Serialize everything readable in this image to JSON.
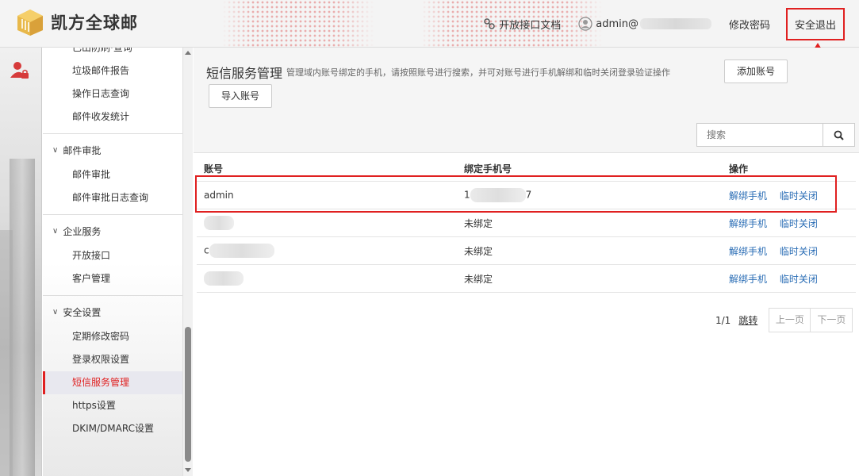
{
  "header": {
    "brand": "凯方全球邮",
    "api_doc": "开放接口文档",
    "user_prefix": "admin@",
    "change_password": "修改密码",
    "logout": "安全退出"
  },
  "sidebar": {
    "items_top": [
      {
        "label": "已出防刷·查询"
      },
      {
        "label": "垃圾邮件报告"
      },
      {
        "label": "操作日志查询"
      },
      {
        "label": "邮件收发统计"
      }
    ],
    "groups": [
      {
        "title": "邮件审批",
        "items": [
          "邮件审批",
          "邮件审批日志查询"
        ]
      },
      {
        "title": "企业服务",
        "items": [
          "开放接口",
          "客户管理"
        ]
      },
      {
        "title": "安全设置",
        "items": [
          "定期修改密码",
          "登录权限设置",
          "短信服务管理",
          "https设置",
          "DKIM/DMARC设置"
        ]
      }
    ],
    "active": "短信服务管理"
  },
  "main": {
    "title": "短信服务管理",
    "description": "管理域内账号绑定的手机，请按照账号进行搜索，并可对账号进行手机解绑和临时关闭登录验证操作",
    "add_button": "添加账号",
    "import_button": "导入账号",
    "search_placeholder": "搜索",
    "columns": [
      "账号",
      "绑定手机号",
      "操作"
    ],
    "rows": [
      {
        "account": "admin",
        "phone": "1",
        "phone_tail": "7"
      },
      {
        "account": "",
        "phone": "未绑定"
      },
      {
        "account": "c",
        "phone": "未绑定"
      },
      {
        "account": "",
        "phone": "未绑定"
      }
    ],
    "actions": {
      "unbind": "解绑手机",
      "close": "临时关闭"
    },
    "pager": {
      "info": "1/1",
      "jump": "跳转",
      "prev": "上一页",
      "next": "下一页"
    }
  },
  "colors": {
    "accent": "#e02020",
    "link": "#2a6db5"
  }
}
